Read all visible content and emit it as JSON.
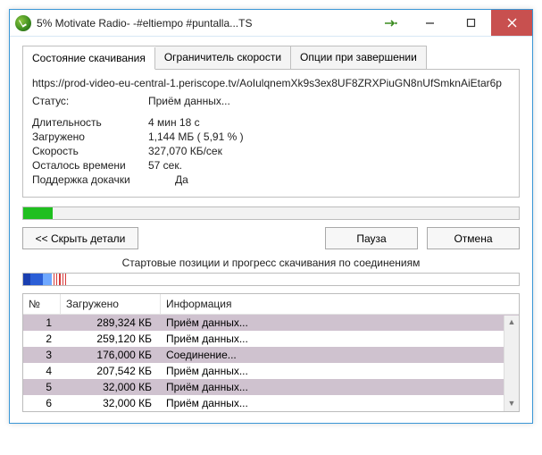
{
  "window": {
    "title": "5% Motivate Radio- -#eltiempo #puntalla...TS"
  },
  "tabs": {
    "items": [
      {
        "label": "Состояние скачивания"
      },
      {
        "label": "Ограничитель скорости"
      },
      {
        "label": "Опции при завершении"
      }
    ]
  },
  "info": {
    "url": "https://prod-video-eu-central-1.periscope.tv/AoIulqnemXk9s3ех8UF8ZRXPiuGN8nUfSmknAiEtar6p",
    "status_label": "Статус:",
    "status_value": "Приём данных...",
    "duration_label": "Длительность",
    "duration_value": "4 мин 18 с",
    "downloaded_label": "Загружено",
    "downloaded_value": "1,144 МБ  ( 5,91 % )",
    "speed_label": "Скорость",
    "speed_value": "327,070 КБ/сек",
    "remaining_label": "Осталось времени",
    "remaining_value": "57 сек.",
    "resume_label": "Поддержка докачки",
    "resume_value": "Да",
    "progress_percent": 5.91
  },
  "buttons": {
    "hide_details": "<< Скрыть детали",
    "pause": "Пауза",
    "cancel": "Отмена"
  },
  "connections": {
    "caption": "Стартовые позиции и прогресс скачивания по соединениям",
    "columns": {
      "n": "№",
      "downloaded": "Загружено",
      "info": "Информация"
    },
    "rows": [
      {
        "n": "1",
        "downloaded": "289,324 КБ",
        "info": "Приём данных..."
      },
      {
        "n": "2",
        "downloaded": "259,120 КБ",
        "info": "Приём данных..."
      },
      {
        "n": "3",
        "downloaded": "176,000 КБ",
        "info": "Соединение..."
      },
      {
        "n": "4",
        "downloaded": "207,542 КБ",
        "info": "Приём данных..."
      },
      {
        "n": "5",
        "downloaded": "32,000 КБ",
        "info": "Приём данных..."
      },
      {
        "n": "6",
        "downloaded": "32,000 КБ",
        "info": "Приём данных..."
      }
    ],
    "segments": [
      {
        "width": 1.4,
        "color": "#1a3fb0"
      },
      {
        "width": 1.3,
        "color": "#2b5ed6"
      },
      {
        "width": 1.2,
        "color": "#2b5ed6"
      },
      {
        "width": 1.8,
        "color": "#6fa8ff"
      },
      {
        "width": 0.4,
        "color": "#ffffff"
      },
      {
        "width": 0.2,
        "color": "#d63a3a"
      },
      {
        "width": 0.4,
        "color": "#ffffff"
      },
      {
        "width": 0.2,
        "color": "#d63a3a"
      },
      {
        "width": 0.4,
        "color": "#ffffff"
      },
      {
        "width": 0.2,
        "color": "#d63a3a"
      },
      {
        "width": 0.4,
        "color": "#ffffff"
      },
      {
        "width": 0.2,
        "color": "#d63a3a"
      },
      {
        "width": 0.4,
        "color": "#ffffff"
      },
      {
        "width": 0.2,
        "color": "#d63a3a"
      },
      {
        "width": 91.3,
        "color": "#ffffff"
      }
    ]
  }
}
